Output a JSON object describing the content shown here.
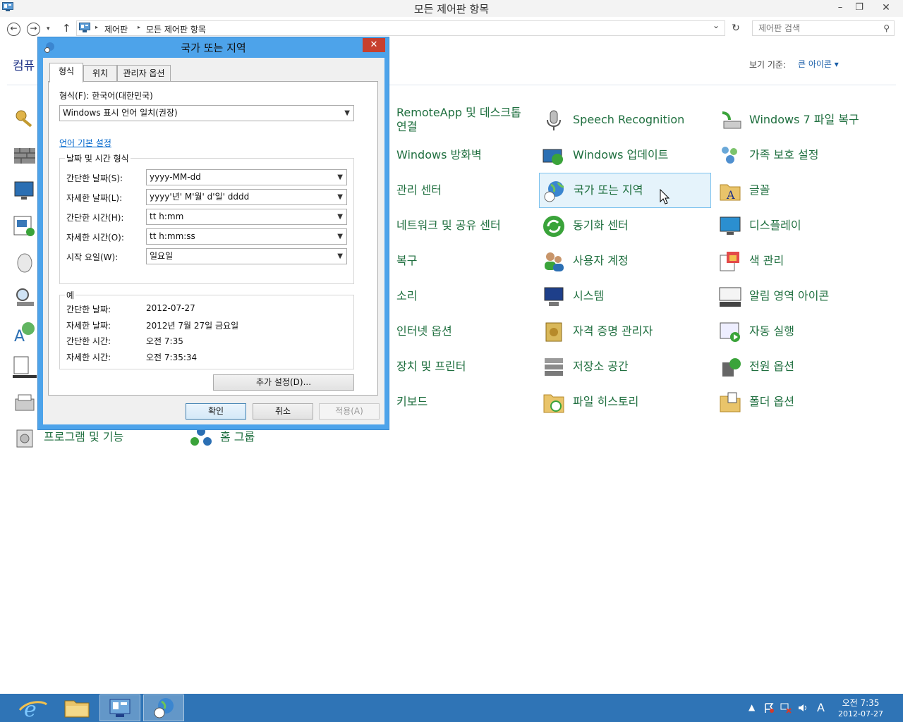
{
  "window": {
    "title": "모든 제어판 항목",
    "minimize": "–",
    "maximize": "❐",
    "close": "✕"
  },
  "address": {
    "back": "←",
    "forward": "→",
    "recent": "▾",
    "up": "↑",
    "crumb_sep": "▸",
    "crumbs": [
      "제어판",
      "모든 제어판 항목"
    ],
    "dropdown": "⌄",
    "refresh": "↻",
    "search_placeholder": "제어판 검색",
    "search_icon": "⚲"
  },
  "page": {
    "heading": "컴퓨",
    "view_by_label": "보기 기준:",
    "view_by_value": "큰 아이콘 ▾"
  },
  "items": [
    {
      "label": "RemoteApp 및 데스크톱 연결",
      "icon": "remoteapp-icon"
    },
    {
      "label": "Speech Recognition",
      "icon": "microphone-icon"
    },
    {
      "label": "Windows 7 파일 복구",
      "icon": "file-recovery-icon"
    },
    {
      "label": "Windows 방화벽",
      "icon": "firewall-icon"
    },
    {
      "label": "Windows 업데이트",
      "icon": "windows-update-icon"
    },
    {
      "label": "가족 보호 설정",
      "icon": "family-safety-icon"
    },
    {
      "label": "관리 센터",
      "icon": "action-center-icon"
    },
    {
      "label": "국가 또는 지역",
      "icon": "region-globe-icon"
    },
    {
      "label": "글꼴",
      "icon": "fonts-folder-icon"
    },
    {
      "label": "네트워크 및 공유 센터",
      "icon": "network-icon"
    },
    {
      "label": "동기화 센터",
      "icon": "sync-center-icon"
    },
    {
      "label": "디스플레이",
      "icon": "display-icon"
    },
    {
      "label": "복구",
      "icon": "recovery-icon"
    },
    {
      "label": "사용자 계정",
      "icon": "user-accounts-icon"
    },
    {
      "label": "색 관리",
      "icon": "color-management-icon"
    },
    {
      "label": "소리",
      "icon": "sound-icon"
    },
    {
      "label": "시스템",
      "icon": "system-icon"
    },
    {
      "label": "알림 영역 아이콘",
      "icon": "notification-area-icon"
    },
    {
      "label": "인터넷 옵션",
      "icon": "internet-options-icon"
    },
    {
      "label": "자격 증명 관리자",
      "icon": "credential-manager-icon"
    },
    {
      "label": "자동 실행",
      "icon": "autoplay-icon"
    },
    {
      "label": "장치 및 프린터",
      "icon": "devices-printers-icon"
    },
    {
      "label": "저장소 공간",
      "icon": "storage-spaces-icon"
    },
    {
      "label": "전원 옵션",
      "icon": "power-options-icon"
    },
    {
      "label": "키보드",
      "icon": "keyboard-icon"
    },
    {
      "label": "파일 히스토리",
      "icon": "file-history-icon"
    },
    {
      "label": "폴더 옵션",
      "icon": "folder-options-icon"
    },
    {
      "label": "프로그램 및 기능",
      "icon": "programs-features-icon"
    },
    {
      "label": "홈 그룹",
      "icon": "homegroup-icon"
    }
  ],
  "dialog": {
    "title": "국가 또는 지역",
    "close": "✕",
    "tabs": [
      "형식",
      "위치",
      "관리자 옵션"
    ],
    "format_label": "형식(F): 한국어(대한민국)",
    "format_value": "Windows 표시 언어 일치(권장)",
    "language_link": "언어 기본 설정",
    "datetime_group": "날짜 및 시간 형식",
    "fields": [
      {
        "label": "간단한 날짜(S):",
        "value": "yyyy-MM-dd"
      },
      {
        "label": "자세한 날짜(L):",
        "value": "yyyy'년' M'월' d'일' dddd"
      },
      {
        "label": "간단한 시간(H):",
        "value": "tt h:mm"
      },
      {
        "label": "자세한 시간(O):",
        "value": "tt h:mm:ss"
      },
      {
        "label": "시작 요일(W):",
        "value": "일요일"
      }
    ],
    "examples_group": "예",
    "examples": [
      {
        "label": "간단한 날짜:",
        "value": "2012-07-27"
      },
      {
        "label": "자세한 날짜:",
        "value": "2012년 7월 27일 금요일"
      },
      {
        "label": "간단한 시간:",
        "value": "오전 7:35"
      },
      {
        "label": "자세한 시간:",
        "value": "오전 7:35:34"
      }
    ],
    "additional_settings": "추가 설정(D)...",
    "ok": "확인",
    "cancel": "취소",
    "apply": "적용(A)"
  },
  "taskbar": {
    "tray_show_hidden": "▲",
    "tray_ime": "A",
    "clock_time": "오전 7:35",
    "clock_date": "2012-07-27"
  },
  "colors": {
    "accent": "#2f74b6",
    "dialog_frame": "#4da3ea",
    "item_text": "#1f6f3f",
    "highlight": "#e5f3fb",
    "close_red": "#c7402f"
  }
}
